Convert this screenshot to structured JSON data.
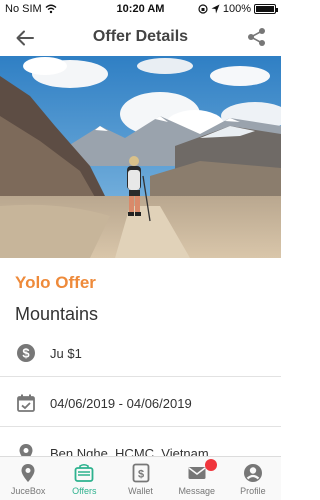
{
  "status_bar": {
    "carrier": "No SIM",
    "time": "10:20 AM",
    "battery": "100%",
    "battery_level": 1.0
  },
  "header": {
    "title": "Offer Details",
    "back_icon": "arrow-back-icon",
    "share_icon": "share-icon"
  },
  "hero_image": {
    "description_icon": "mountain-hiker-photo"
  },
  "offer": {
    "type": "Yolo Offer",
    "name": "Mountains",
    "price": "Ju $1",
    "date_range": "04/06/2019 - 04/06/2019",
    "location": "Ben Nghe, HCMC, Vietnam"
  },
  "tabs": [
    {
      "label": "JuceBox",
      "icon": "location-pin-icon",
      "active": false
    },
    {
      "label": "Offers",
      "icon": "offers-bag-icon",
      "active": true
    },
    {
      "label": "Wallet",
      "icon": "wallet-icon",
      "active": false
    },
    {
      "label": "Message",
      "icon": "mail-icon",
      "active": false
    },
    {
      "label": "Profile",
      "icon": "profile-icon",
      "active": false
    }
  ],
  "colors": {
    "accent": "#2db28e",
    "offer_type": "#ee8a3a",
    "badge": "#f0363d",
    "icon": "#777777"
  }
}
